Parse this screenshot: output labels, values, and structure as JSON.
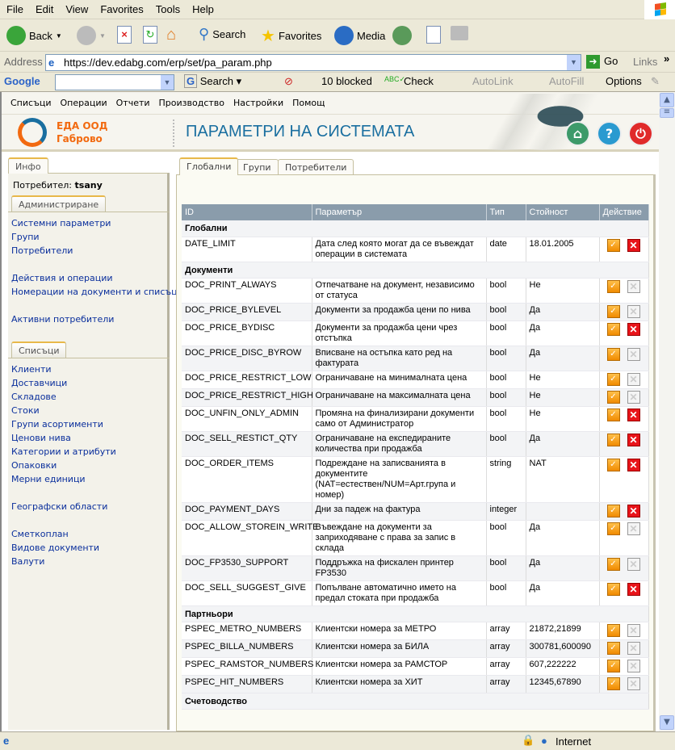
{
  "browser": {
    "menu": [
      "File",
      "Edit",
      "View",
      "Favorites",
      "Tools",
      "Help"
    ],
    "toolbar": {
      "back": "Back",
      "search": "Search",
      "favorites": "Favorites",
      "media": "Media"
    },
    "address_label": "Address",
    "url": "https://dev.edabg.com/erp/set/pa_param.php",
    "go": "Go",
    "links": "Links",
    "google": {
      "logo": "Google",
      "search": "Search",
      "blocked": "10 blocked",
      "check": "Check",
      "autolink": "AutoLink",
      "autofill": "AutoFill",
      "options": "Options"
    },
    "status": {
      "zone": "Internet"
    }
  },
  "app": {
    "nav": [
      "Списъци",
      "Операции",
      "Отчети",
      "Производство",
      "Настройки",
      "Помощ"
    ],
    "company": "ЕДА ООД",
    "city": "Габрово",
    "title": "ПАРАМЕТРИ НА СИСТЕМАТА",
    "colors": {
      "title": "#1a6fa0",
      "company": "#f26a10",
      "link": "#0a2f9c",
      "table_header": "#8a9cab"
    }
  },
  "sidebar": {
    "info_tab": "Инфо",
    "user_label": "Потребител:",
    "user": "tsany",
    "admin_tab": "Администриране",
    "admin_links": [
      [
        "Системни параметри",
        "Групи",
        "Потребители"
      ],
      [
        "Действия и операции",
        "Номерации на документи и списъци"
      ],
      [
        "Активни потребители"
      ]
    ],
    "lists_tab": "Списъци",
    "lists_links": [
      [
        "Клиенти",
        "Доставчици",
        "Складове",
        "Стоки",
        "Групи асортименти",
        "Ценови нива",
        "Категории и атрибути",
        "Опаковки",
        "Мерни единици"
      ],
      [
        "Географски области"
      ],
      [
        "Сметкоплан",
        "Видове документи",
        "Валути"
      ]
    ]
  },
  "tabs": [
    "Глобални",
    "Групи",
    "Потребители"
  ],
  "table": {
    "columns": [
      "ID",
      "Параметър",
      "Тип",
      "Стойност",
      "Действие"
    ],
    "groups": [
      {
        "name": "Глобални",
        "rows": [
          {
            "id": "DATE_LIMIT",
            "param": "Дата след която могат да се въвеждат операции в системата",
            "type": "date",
            "value": "18.01.2005",
            "deletable": true
          }
        ]
      },
      {
        "name": "Документи",
        "rows": [
          {
            "id": "DOC_PRINT_ALWAYS",
            "param": "Отпечатване на документ, независимо от статуса",
            "type": "bool",
            "value": "Не",
            "deletable": false
          },
          {
            "id": "DOC_PRICE_BYLEVEL",
            "param": "Документи за продажба цени по нива",
            "type": "bool",
            "value": "Да",
            "deletable": false
          },
          {
            "id": "DOC_PRICE_BYDISC",
            "param": "Документи за продажба цени чрез отстъпка",
            "type": "bool",
            "value": "Да",
            "deletable": true
          },
          {
            "id": "DOC_PRICE_DISC_BYROW",
            "param": "Вписване на остъпка като ред на фактурата",
            "type": "bool",
            "value": "Да",
            "deletable": false
          },
          {
            "id": "DOC_PRICE_RESTRICT_LOW",
            "param": "Ограничаване на минималната цена",
            "type": "bool",
            "value": "Не",
            "deletable": false
          },
          {
            "id": "DOC_PRICE_RESTRICT_HIGH",
            "param": "Ограничаване на максималната цена",
            "type": "bool",
            "value": "Не",
            "deletable": false
          },
          {
            "id": "DOC_UNFIN_ONLY_ADMIN",
            "param": "Промяна на финализирани документи само от Администратор",
            "type": "bool",
            "value": "Не",
            "deletable": true
          },
          {
            "id": "DOC_SELL_RESTICT_QTY",
            "param": "Ограничаване на експедираните количества при продажба",
            "type": "bool",
            "value": "Да",
            "deletable": true
          },
          {
            "id": "DOC_ORDER_ITEMS",
            "param": "Подреждане на записванията в документите (NAT=естествен/NUM=Арт.група и номер)",
            "type": "string",
            "value": "NAT",
            "deletable": true
          },
          {
            "id": "DOC_PAYMENT_DAYS",
            "param": "Дни за падеж на фактура",
            "type": "integer",
            "value": "",
            "deletable": true
          },
          {
            "id": "DOC_ALLOW_STOREIN_WRITE",
            "param": "Въвеждане на документи за заприходяване с права за запис в склада",
            "type": "bool",
            "value": "Да",
            "deletable": false
          },
          {
            "id": "DOC_FP3530_SUPPORT",
            "param": "Поддръжка на фискален принтер FP3530",
            "type": "bool",
            "value": "Да",
            "deletable": false
          },
          {
            "id": "DOC_SELL_SUGGEST_GIVE",
            "param": "Попълване автоматично името на предал стоката при продажба",
            "type": "bool",
            "value": "Да",
            "deletable": true
          }
        ]
      },
      {
        "name": "Партньори",
        "rows": [
          {
            "id": "PSPEC_METRO_NUMBERS",
            "param": "Клиентски номера за МЕТРО",
            "type": "array",
            "value": "21872,21899",
            "deletable": false
          },
          {
            "id": "PSPEC_BILLA_NUMBERS",
            "param": "Клиентски номера за БИЛА",
            "type": "array",
            "value": "300781,600090",
            "deletable": false
          },
          {
            "id": "PSPEC_RAMSTOR_NUMBERS",
            "param": "Клиентски номера за РАМСТОР",
            "type": "array",
            "value": "607,222222",
            "deletable": false
          },
          {
            "id": "PSPEC_HIT_NUMBERS",
            "param": "Клиентски номера за ХИТ",
            "type": "array",
            "value": "12345,67890",
            "deletable": false
          }
        ]
      },
      {
        "name": "Счетоводство",
        "rows": []
      }
    ]
  }
}
